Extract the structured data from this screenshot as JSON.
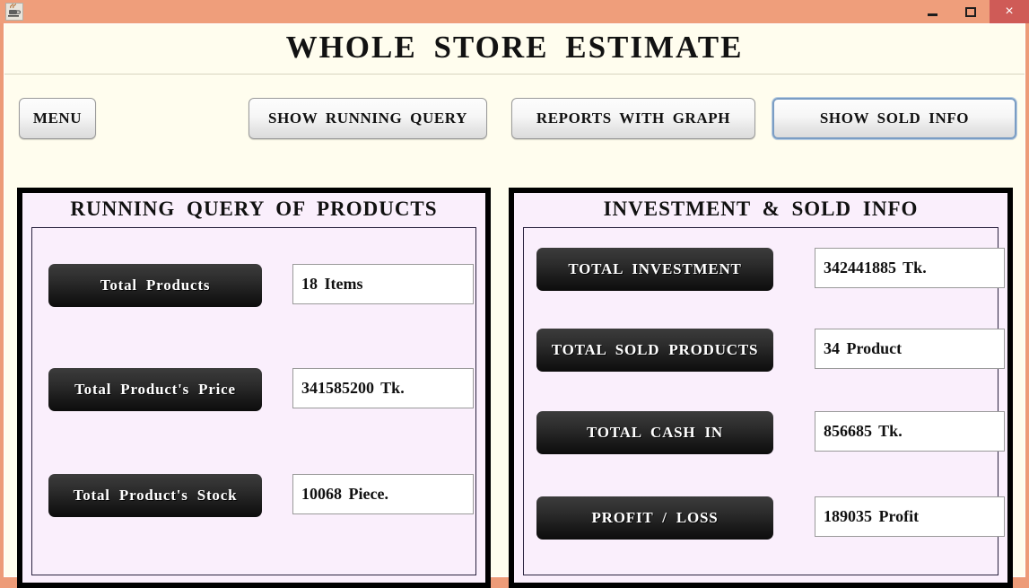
{
  "window": {
    "app_icon": "java-coffee-cup-icon",
    "controls": {
      "minimize": "minimize-icon",
      "maximize": "maximize-icon",
      "close": "×"
    }
  },
  "header": {
    "title": "WHOLE  STORE  ESTIMATE"
  },
  "toolbar": {
    "menu_label": "MENU",
    "running_query_label": "SHOW  RUNNING  QUERY",
    "reports_label": "REPORTS  WITH  GRAPH",
    "sold_info_label": "SHOW  SOLD  INFO"
  },
  "left_panel": {
    "title": "RUNNING  QUERY  OF  PRODUCTS",
    "rows": [
      {
        "label": "Total   Products",
        "value": "18  Items"
      },
      {
        "label": "Total  Product's  Price",
        "value": "341585200  Tk."
      },
      {
        "label": "Total  Product's  Stock",
        "value": "10068  Piece."
      }
    ]
  },
  "right_panel": {
    "title": "INVESTMENT  &  SOLD  INFO",
    "rows": [
      {
        "label": "TOTAL    INVESTMENT",
        "value": "342441885  Tk."
      },
      {
        "label": "TOTAL  SOLD  PRODUCTS",
        "value": "34   Product"
      },
      {
        "label": "TOTAL  CASH  IN",
        "value": "856685  Tk."
      },
      {
        "label": "PROFIT / LOSS",
        "value": "189035  Profit"
      }
    ]
  },
  "colors": {
    "window_frame": "#ed9b78",
    "app_background": "#fffdee",
    "panel_background": "#faeffc",
    "panel_border": "#000000",
    "dark_button": "#1a1a1a",
    "close_button": "#cf5b57",
    "focus_border": "#7a9dc4"
  }
}
